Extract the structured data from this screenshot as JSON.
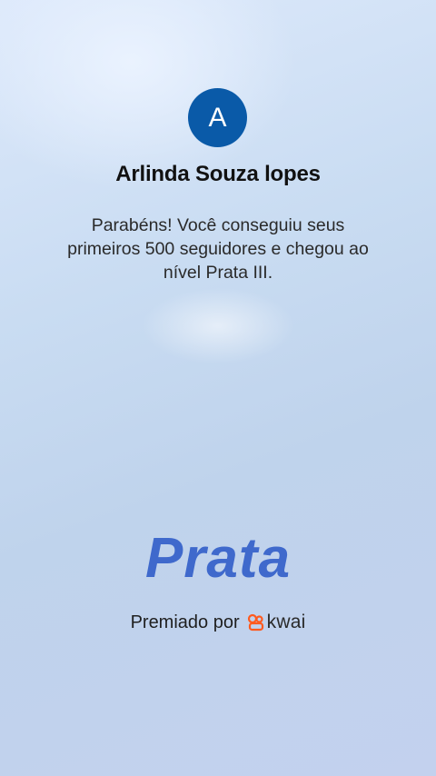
{
  "profile": {
    "avatar_initial": "A",
    "name": "Arlinda Souza lopes"
  },
  "message": "Parabéns! Você conseguiu seus primeiros 500 seguidores e chegou ao nível Prata III.",
  "level": {
    "title": "Prata"
  },
  "award": {
    "label": "Premiado por",
    "brand": "kwai",
    "brand_icon": "kwai-logo-icon"
  },
  "colors": {
    "avatar_bg": "#0a5aa8",
    "level_text": "#3f69cc",
    "brand_orange": "#ff5a1f"
  }
}
